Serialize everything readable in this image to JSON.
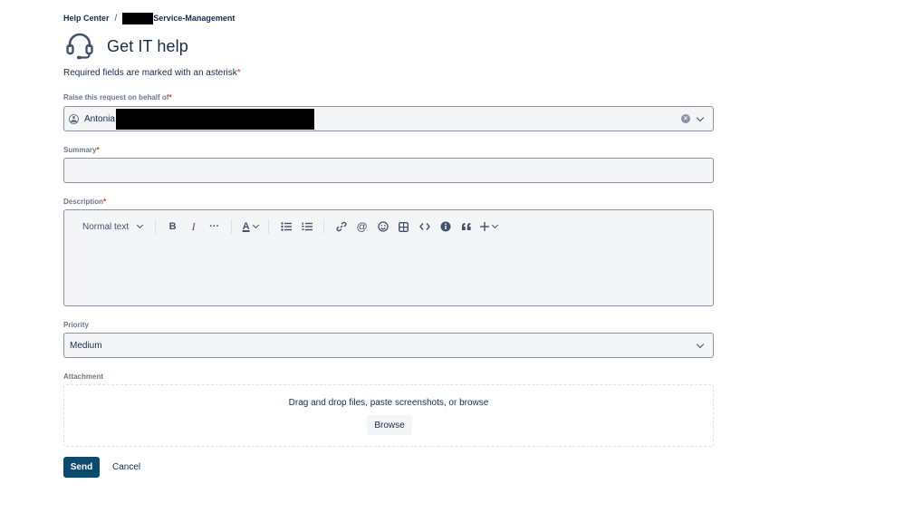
{
  "breadcrumb": {
    "root": "Help Center",
    "separator": "/",
    "portal": "Service-Management"
  },
  "header": {
    "icon": "headset-icon",
    "title": "Get IT help"
  },
  "form": {
    "required_note": "Required fields are marked with an asterisk",
    "asterisk": "*",
    "on_behalf": {
      "label": "Raise this request on behalf of",
      "value": "Antonia"
    },
    "summary": {
      "label": "Summary",
      "value": ""
    },
    "description": {
      "label": "Description",
      "value": "",
      "toolbar": {
        "text_style": "Normal text",
        "bold": "B",
        "italic": "I",
        "more": "···",
        "text_color": "A"
      }
    },
    "priority": {
      "label": "Priority",
      "value": "Medium"
    },
    "attachment": {
      "label": "Attachment",
      "drop_text": "Drag and drop files, paste screenshots, or browse",
      "browse_label": "Browse"
    },
    "actions": {
      "send_label": "Send",
      "cancel_label": "Cancel"
    }
  },
  "colors": {
    "primary_button": "#0c4a6e",
    "required_star": "#de350b",
    "text": "#172b4d"
  }
}
